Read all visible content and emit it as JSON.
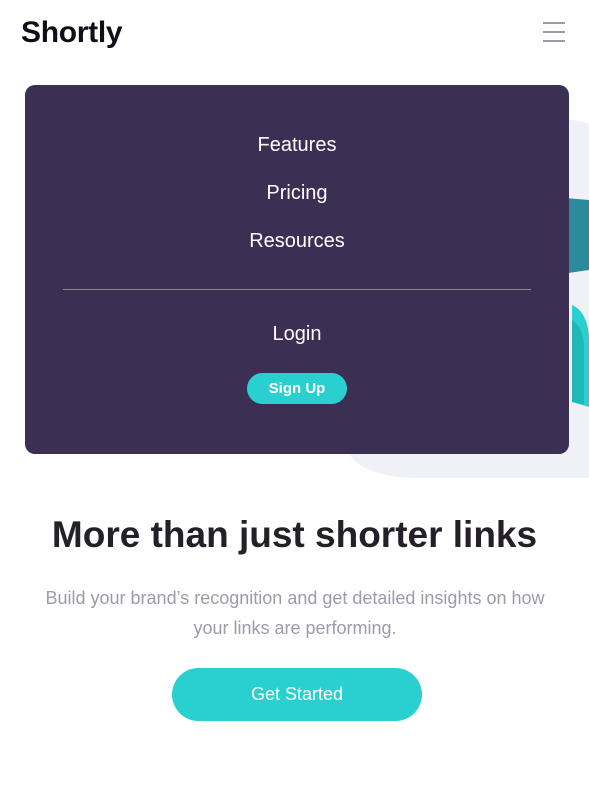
{
  "header": {
    "logo": "Shortly",
    "menu_icon": "hamburger-icon"
  },
  "menu": {
    "items": [
      {
        "label": "Features"
      },
      {
        "label": "Pricing"
      },
      {
        "label": "Resources"
      }
    ],
    "login_label": "Login",
    "signup_label": "Sign Up"
  },
  "hero": {
    "title": "More than just shorter links",
    "description": "Build your brand’s recognition and get detailed insights on how your links are performing.",
    "cta_label": "Get Started",
    "illustration": "person-working-illustration"
  },
  "colors": {
    "accent": "#2acfcf",
    "menu_background": "#3b3054",
    "text_dark": "#232127",
    "text_muted": "#9e9aa8"
  }
}
